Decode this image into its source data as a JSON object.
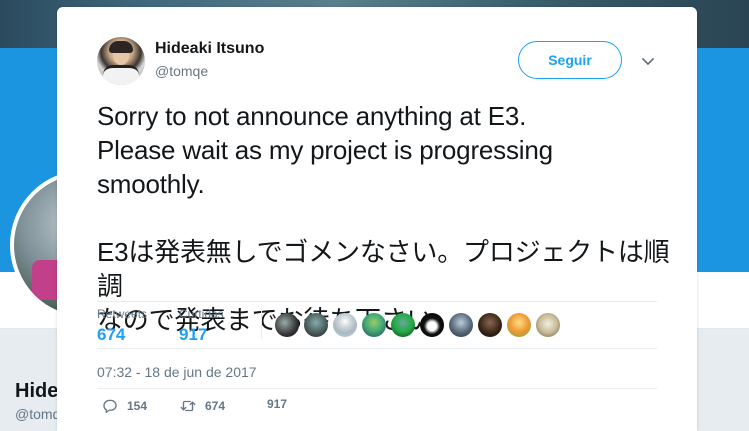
{
  "background_profile": {
    "name": "Hide",
    "handle": "@tomq"
  },
  "tweet": {
    "author_name": "Hideaki Itsuno",
    "author_handle": "@tomqe",
    "follow_label": "Seguir",
    "text_en_line1": "Sorry to not announce anything at E3.",
    "text_en_line2": "Please wait as my project is progressing",
    "text_en_line3": "smoothly.",
    "text_ja_line1": "E3は発表無しでゴメンなさい。プロジェクトは順調",
    "text_ja_line2": "なので発表までお待ち下さい。",
    "stats": {
      "retweets_label": "Retweets",
      "retweets_count": "674",
      "likes_label": "Curtidas",
      "likes_count": "917"
    },
    "timestamp": "07:32 - 18 de jun de 2017",
    "actions": {
      "reply_count": "154",
      "retweet_count": "674",
      "like_count": "917"
    }
  },
  "icons": {
    "caret": "chevron-down-icon",
    "reply": "reply-icon",
    "retweet": "retweet-icon",
    "like": "heart-icon"
  },
  "colors": {
    "accent": "#1da1f2",
    "profile_banner": "#1b95e0",
    "muted_text": "#657786",
    "primary_text": "#14171a"
  }
}
